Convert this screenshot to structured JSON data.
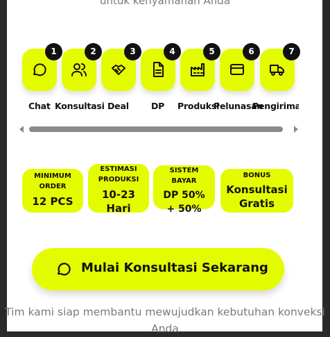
{
  "header": {
    "subtitle_tail": "untuk kenyamanan Anda"
  },
  "steps": [
    {
      "num": "1",
      "label": "Chat",
      "icon": "chat-icon"
    },
    {
      "num": "2",
      "label": "Konsultasi",
      "icon": "users-icon"
    },
    {
      "num": "3",
      "label": "Deal",
      "icon": "handshake-icon"
    },
    {
      "num": "4",
      "label": "DP",
      "icon": "document-icon"
    },
    {
      "num": "5",
      "label": "Produksi",
      "icon": "factory-icon"
    },
    {
      "num": "6",
      "label": "Pelunasan",
      "icon": "card-icon"
    },
    {
      "num": "7",
      "label": "Pengiriman",
      "icon": "truck-icon"
    }
  ],
  "info": [
    {
      "caption": "MINIMUM ORDER",
      "value": "12 PCS"
    },
    {
      "caption": "ESTIMASI PRODUKSI",
      "value": "10-23 Hari"
    },
    {
      "caption": "SISTEM BAYAR",
      "value": "DP 50% + 50%"
    },
    {
      "caption": "BONUS",
      "value": "Konsultasi Gratis"
    }
  ],
  "cta": {
    "label": "Mulai Konsultasi Sekarang",
    "icon": "chat-icon"
  },
  "footer": {
    "text": "Tim kami siap membantu mewujudkan kebutuhan konveksi Anda"
  },
  "colors": {
    "accent": "#e4fc00",
    "badge": "#111111",
    "muted_text": "#7a7a7a",
    "background": "#2a2a2a"
  }
}
